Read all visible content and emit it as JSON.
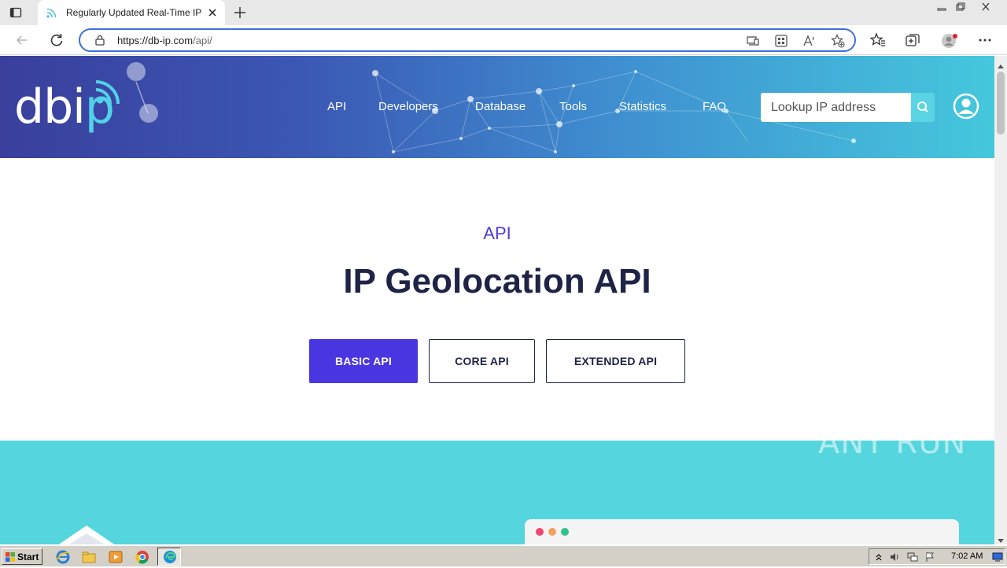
{
  "browser": {
    "tab_title": "Regularly Updated Real-Time IP G",
    "url_host": "https://db-ip.com",
    "url_path": "/api/",
    "tab_icons": [
      "tab-actions-icon",
      "wifi-favicon-icon",
      "close-icon",
      "new-tab-icon"
    ],
    "toolbar_icons": [
      "back-icon",
      "refresh-icon",
      "lock-icon",
      "device-icon",
      "apps-icon",
      "read-aloud-icon",
      "add-favorite-icon",
      "favorites-icon",
      "collections-icon",
      "profile-icon",
      "more-icon"
    ]
  },
  "site": {
    "logo_text_a": "db",
    "logo_text_i": "i",
    "logo_text_p": "p",
    "nav": [
      "API",
      "Developers",
      "Database",
      "Tools",
      "Statistics",
      "FAQ"
    ],
    "search_placeholder": "Lookup IP address",
    "colors": {
      "hero_start": "#3a3f9c",
      "hero_end": "#45c8dd",
      "accent": "#4a36e0",
      "band": "#55d5de",
      "heading": "#1f2346"
    }
  },
  "main": {
    "section_label": "API",
    "title": "IP Geolocation API",
    "buttons": {
      "basic": "BASIC API",
      "core": "CORE API",
      "extended": "EXTENDED API"
    }
  },
  "watermark": "ANY RUN",
  "taskbar": {
    "start_label": "Start",
    "clock": "7:02 AM",
    "quick_launch": [
      "ie-icon",
      "explorer-icon",
      "media-player-icon",
      "chrome-icon",
      "edge-icon"
    ],
    "tray": [
      "chevron-up-icon",
      "volume-icon",
      "network-icon",
      "flag-icon",
      "display-icon"
    ]
  }
}
